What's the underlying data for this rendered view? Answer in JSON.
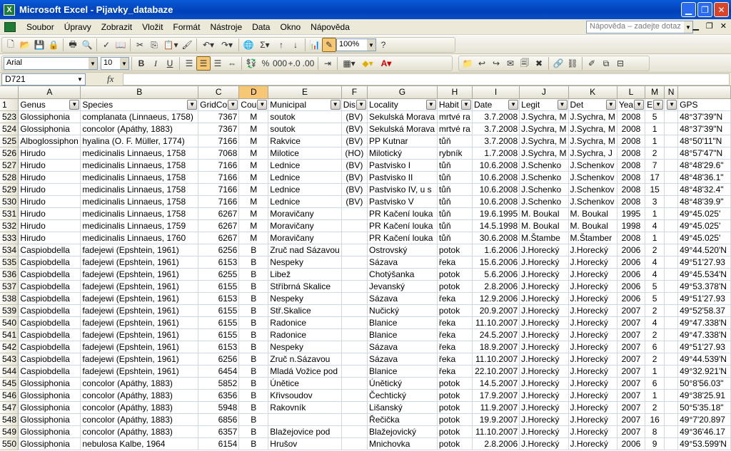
{
  "window": {
    "title": "Microsoft Excel - Pijavky_databaze",
    "app_icon_glyph": "X"
  },
  "menubar": {
    "items": [
      "Soubor",
      "Úpravy",
      "Zobrazit",
      "Vložit",
      "Formát",
      "Nástroje",
      "Data",
      "Okno",
      "Nápověda"
    ],
    "help_placeholder": "Nápověda – zadejte dotaz"
  },
  "toolbar": {
    "zoom": "100%",
    "font": "Arial",
    "font_size": "10"
  },
  "formula_bar": {
    "cell_ref": "D721",
    "fx": "fx",
    "content": ""
  },
  "columns": [
    {
      "letter": "A",
      "header": "Genus",
      "filter": true
    },
    {
      "letter": "B",
      "header": "Species",
      "filter": true
    },
    {
      "letter": "C",
      "header": "GridCo",
      "filter": true
    },
    {
      "letter": "D",
      "header": "Cou",
      "filter": true,
      "selected": true
    },
    {
      "letter": "E",
      "header": "Municipal",
      "filter": true
    },
    {
      "letter": "F",
      "header": "Dis",
      "filter": true
    },
    {
      "letter": "G",
      "header": "Locality",
      "filter": true
    },
    {
      "letter": "H",
      "header": "Habit",
      "filter": true
    },
    {
      "letter": "I",
      "header": "Date",
      "filter": true
    },
    {
      "letter": "J",
      "header": "Legit",
      "filter": true
    },
    {
      "letter": "K",
      "header": "Det",
      "filter": true
    },
    {
      "letter": "L",
      "header": "Yea",
      "filter": true
    },
    {
      "letter": "M",
      "header": "E",
      "filter": true
    },
    {
      "letter": "N",
      "header": "",
      "filter": true
    },
    {
      "letter": "",
      "header": "GPS",
      "filter": false
    }
  ],
  "rows": [
    [
      "523",
      "Glossiphonia",
      "complanata (Linnaeus, 1758)",
      "7367",
      "M",
      "soutok",
      "(BV)",
      "Sekulská Morava",
      "mrtvé ra",
      "3.7.2008",
      "J.Sychra, M",
      "J.Sychra, M",
      "2008",
      "5",
      "",
      "48°37'39\"N"
    ],
    [
      "524",
      "Glossiphonia",
      "concolor (Apáthy, 1883)",
      "7367",
      "M",
      "soutok",
      "(BV)",
      "Sekulská Morava",
      "mrtvé ra",
      "3.7.2008",
      "J.Sychra, M",
      "J.Sychra, M",
      "2008",
      "1",
      "",
      "48°37'39\"N"
    ],
    [
      "525",
      "Alboglossiphon",
      "hyalina (O. F. Müller, 1774)",
      "7166",
      "M",
      "Rakvice",
      "(BV)",
      "PP Kutnar",
      "tůň",
      "3.7.2008",
      "J.Sychra, M",
      "J.Sychra, M",
      "2008",
      "1",
      "",
      "48°50'11\"N"
    ],
    [
      "526",
      "Hirudo",
      "medicinalis Linnaeus, 1758",
      "7068",
      "M",
      "Milotice",
      "(HO)",
      "Milotický",
      "rybník",
      "1.7.2008",
      "J.Sychra, M",
      "J.Sychra, J",
      "2008",
      "2",
      "",
      "48°57'47\"N"
    ],
    [
      "527",
      "Hirudo",
      "medicinalis Linnaeus, 1758",
      "7166",
      "M",
      "Lednice",
      "(BV)",
      "Pastvisko I",
      "tůň",
      "10.6.2008",
      "J.Schenko",
      "J.Schenkov",
      "2008",
      "7",
      "",
      "48°48'29.6\""
    ],
    [
      "528",
      "Hirudo",
      "medicinalis Linnaeus, 1758",
      "7166",
      "M",
      "Lednice",
      "(BV)",
      "Pastvisko II",
      "tůň",
      "10.6.2008",
      "J.Schenko",
      "J.Schenkov",
      "2008",
      "17",
      "",
      "48°48'36.1\""
    ],
    [
      "529",
      "Hirudo",
      "medicinalis Linnaeus, 1758",
      "7166",
      "M",
      "Lednice",
      "(BV)",
      "Pastvisko IV, u s",
      "tůň",
      "10.6.2008",
      "J.Schenko",
      "J.Schenkov",
      "2008",
      "15",
      "",
      "48°48'32.4\""
    ],
    [
      "530",
      "Hirudo",
      "medicinalis Linnaeus, 1758",
      "7166",
      "M",
      "Lednice",
      "(BV)",
      "Pastvisko V",
      "tůň",
      "10.6.2008",
      "J.Schenko",
      "J.Schenkov",
      "2008",
      "3",
      "",
      "48°48'39.9\""
    ],
    [
      "531",
      "Hirudo",
      "medicinalis Linnaeus, 1758",
      "6267",
      "M",
      "Moravičany",
      "",
      "PR Kačení louka",
      "tůň",
      "19.6.1995",
      "M. Boukal",
      "M. Boukal",
      "1995",
      "1",
      "",
      "49°45.025'"
    ],
    [
      "532",
      "Hirudo",
      "medicinalis Linnaeus, 1759",
      "6267",
      "M",
      "Moravičany",
      "",
      "PR Kačení louka",
      "tůň",
      "14.5.1998",
      "M. Boukal",
      "M. Boukal",
      "1998",
      "4",
      "",
      "49°45.025'"
    ],
    [
      "533",
      "Hirudo",
      "medicinalis Linnaeus, 1760",
      "6267",
      "M",
      "Moravičany",
      "",
      "PR Kačení louka",
      "tůň",
      "30.6.2008",
      "M.Štambe",
      "M.Štamber",
      "2008",
      "1",
      "",
      "49°45.025'"
    ],
    [
      "534",
      "Caspiobdella",
      "fadejewi (Epshtein, 1961)",
      "6256",
      "B",
      "Zruč nad Sázavou",
      "",
      "Ostrovský",
      "potok",
      "1.6.2006",
      "J.Horecký",
      "J.Horecký",
      "2006",
      "2",
      "",
      "49°44.520'N"
    ],
    [
      "535",
      "Caspiobdella",
      "fadejewi (Epshtein, 1961)",
      "6153",
      "B",
      "Nespeky",
      "",
      "Sázava",
      "řeka",
      "15.6.2006",
      "J.Horecký",
      "J.Horecký",
      "2006",
      "4",
      "",
      "49°51'27.93"
    ],
    [
      "536",
      "Caspiobdella",
      "fadejewi (Epshtein, 1961)",
      "6255",
      "B",
      "Libež",
      "",
      "Chotýšanka",
      "potok",
      "5.6.2006",
      "J.Horecký",
      "J.Horecký",
      "2006",
      "4",
      "",
      "49°45.534'N"
    ],
    [
      "537",
      "Caspiobdella",
      "fadejewi (Epshtein, 1961)",
      "6155",
      "B",
      "Stříbrná Skalice",
      "",
      "Jevanský",
      "potok",
      "2.8.2006",
      "J.Horecký",
      "J.Horecký",
      "2006",
      "5",
      "",
      "49°53.378'N"
    ],
    [
      "538",
      "Caspiobdella",
      "fadejewi (Epshtein, 1961)",
      "6153",
      "B",
      "Nespeky",
      "",
      "Sázava",
      "řeka",
      "12.9.2006",
      "J.Horecký",
      "J.Horecký",
      "2006",
      "5",
      "",
      "49°51'27.93"
    ],
    [
      "539",
      "Caspiobdella",
      "fadejewi (Epshtein, 1961)",
      "6155",
      "B",
      "Stř.Skalice",
      "",
      "Nučický",
      "potok",
      "20.9.2007",
      "J.Horecký",
      "J.Horecký",
      "2007",
      "2",
      "",
      "49°52'58.37"
    ],
    [
      "540",
      "Caspiobdella",
      "fadejewi (Epshtein, 1961)",
      "6155",
      "B",
      "Radonice",
      "",
      "Blanice",
      "řeka",
      "11.10.2007",
      "J.Horecký",
      "J.Horecký",
      "2007",
      "4",
      "",
      "49°47.338'N"
    ],
    [
      "541",
      "Caspiobdella",
      "fadejewi (Epshtein, 1961)",
      "6155",
      "B",
      "Radonice",
      "",
      "Blanice",
      "řeka",
      "24.5.2007",
      "J.Horecký",
      "J.Horecký",
      "2007",
      "2",
      "",
      "49°47.338'N"
    ],
    [
      "542",
      "Caspiobdella",
      "fadejewi (Epshtein, 1961)",
      "6153",
      "B",
      "Nespeky",
      "",
      "Sázava",
      "řeka",
      "18.9.2007",
      "J.Horecký",
      "J.Horecký",
      "2007",
      "6",
      "",
      "49°51'27.93"
    ],
    [
      "543",
      "Caspiobdella",
      "fadejewi (Epshtein, 1961)",
      "6256",
      "B",
      "Zruč n.Sázavou",
      "",
      "Sázava",
      "řeka",
      "11.10.2007",
      "J.Horecký",
      "J.Horecký",
      "2007",
      "2",
      "",
      "49°44.539'N"
    ],
    [
      "544",
      "Caspiobdella",
      "fadejewi (Epshtein, 1961)",
      "6454",
      "B",
      "Mladá Vožice pod",
      "",
      "Blanice",
      "řeka",
      "22.10.2007",
      "J.Horecký",
      "J.Horecký",
      "2007",
      "1",
      "",
      "49°32.921'N"
    ],
    [
      "545",
      "Glossiphonia",
      "concolor (Apáthy, 1883)",
      "5852",
      "B",
      "Únětice",
      "",
      "Únětický",
      "potok",
      "14.5.2007",
      "J.Horecký",
      "J.Horecký",
      "2007",
      "6",
      "",
      "50°8'56.03\""
    ],
    [
      "546",
      "Glossiphonia",
      "concolor (Apáthy, 1883)",
      "6356",
      "B",
      "Křivsoudov",
      "",
      "Čechtický",
      "potok",
      "17.9.2007",
      "J.Horecký",
      "J.Horecký",
      "2007",
      "1",
      "",
      "49°38'25.91"
    ],
    [
      "547",
      "Glossiphonia",
      "concolor (Apáthy, 1883)",
      "5948",
      "B",
      "Rakovník",
      "",
      "Lišanský",
      "potok",
      "11.9.2007",
      "J.Horecký",
      "J.Horecký",
      "2007",
      "2",
      "",
      "50°5'35.18\""
    ],
    [
      "548",
      "Glossiphonia",
      "concolor (Apáthy, 1883)",
      "6856",
      "B",
      "",
      "",
      "Řečička",
      "potok",
      "19.9.2007",
      "J.Horecký",
      "J.Horecký",
      "2007",
      "16",
      "",
      "49°7'20.897"
    ],
    [
      "549",
      "Glossiphonia",
      "concolor (Apáthy, 1883)",
      "6357",
      "B",
      "Blažejovice pod",
      "",
      "Blažejovický",
      "potok",
      "11.10.2007",
      "J.Horecký",
      "J.Horecký",
      "2007",
      "8",
      "",
      "49°36'46.17"
    ],
    [
      "550",
      "Glossiphonia",
      "nebulosa Kalbe, 1964",
      "6154",
      "B",
      "Hrušov",
      "",
      "Mnichovka",
      "potok",
      "2.8.2006",
      "J.Horecký",
      "J.Horecký",
      "2006",
      "9",
      "",
      "49°53.599'N"
    ]
  ]
}
